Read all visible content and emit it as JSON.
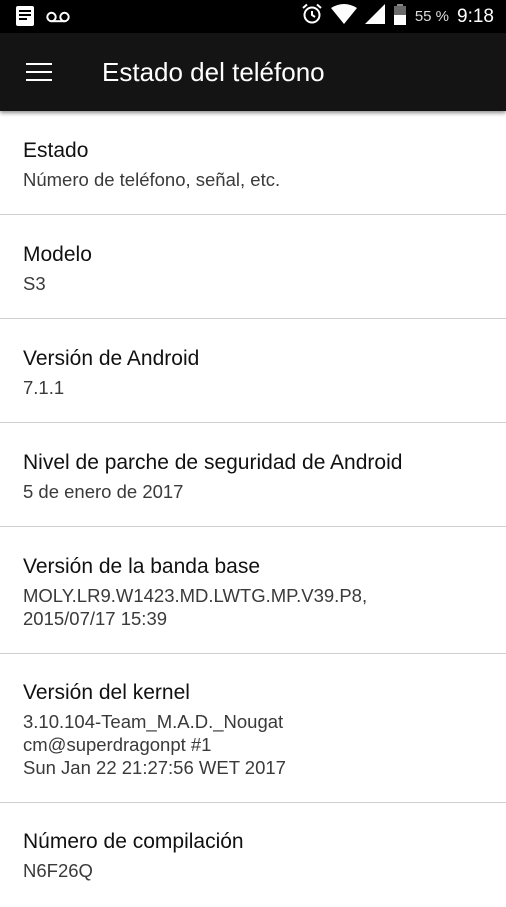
{
  "status_bar": {
    "battery_percent": "55 %",
    "time": "9:18",
    "icons": [
      "notification-icon",
      "voicemail-icon",
      "alarm-icon",
      "wifi-icon",
      "signal-icon",
      "battery-icon"
    ]
  },
  "toolbar": {
    "title": "Estado del teléfono",
    "menu_icon": "hamburger-menu-icon"
  },
  "items": [
    {
      "title": "Estado",
      "subtitle": "Número de teléfono, señal, etc."
    },
    {
      "title": "Modelo",
      "subtitle": "S3"
    },
    {
      "title": "Versión de Android",
      "subtitle": "7.1.1"
    },
    {
      "title": "Nivel de parche de seguridad de Android",
      "subtitle": "5 de enero de 2017"
    },
    {
      "title": "Versión de la banda base",
      "subtitle": "MOLY.LR9.W1423.MD.LWTG.MP.V39.P8,\n2015/07/17 15:39"
    },
    {
      "title": "Versión del kernel",
      "subtitle": "3.10.104-Team_M.A.D._Nougat\ncm@superdragonpt #1\nSun Jan 22 21:27:56 WET 2017"
    },
    {
      "title": "Número de compilación",
      "subtitle": "N6F26Q"
    }
  ]
}
